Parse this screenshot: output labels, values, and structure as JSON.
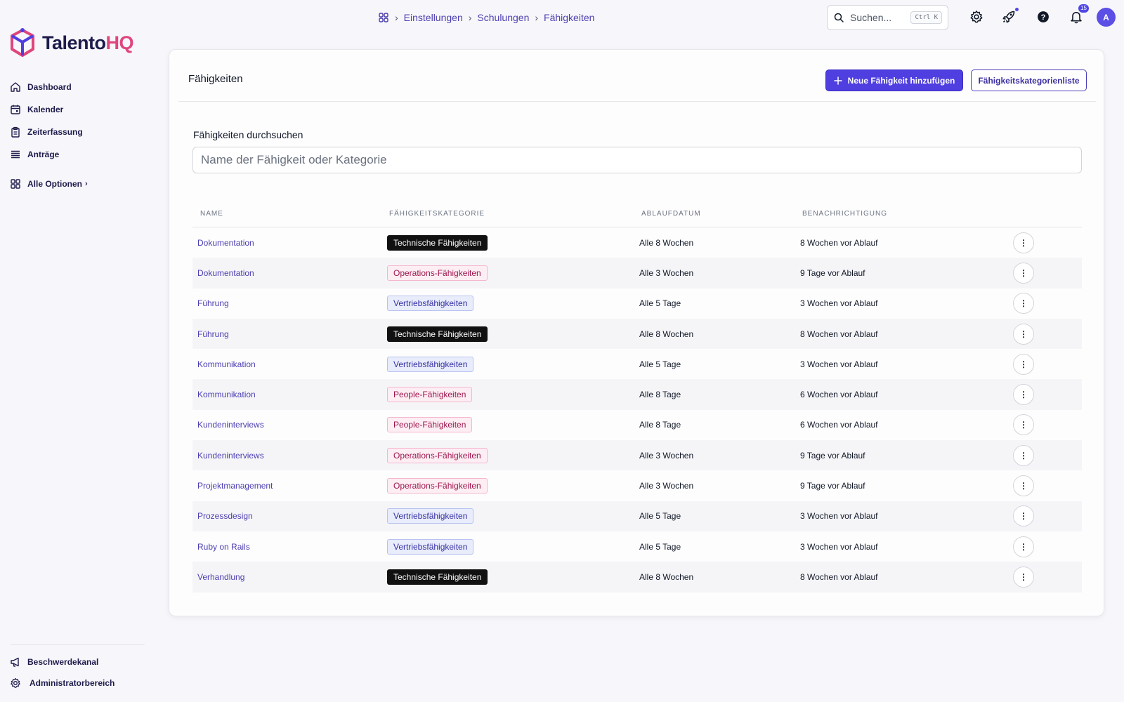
{
  "brand": {
    "name_main": "Talento",
    "name_accent": "HQ",
    "accent_color": "#e0457b",
    "primary_color": "#4f3ee0"
  },
  "sidebar": {
    "items": [
      {
        "label": "Dashboard",
        "icon": "home-icon"
      },
      {
        "label": "Kalender",
        "icon": "calendar-icon"
      },
      {
        "label": "Zeiterfassung",
        "icon": "clipboard-icon"
      },
      {
        "label": "Anträge",
        "icon": "list-icon"
      }
    ],
    "all_options": {
      "label": "Alle Optionen",
      "icon": "grid-icon"
    },
    "bottom": [
      {
        "label": "Beschwerdekanal",
        "icon": "megaphone-icon"
      },
      {
        "label": "Administratorbereich",
        "icon": "gear-icon"
      }
    ]
  },
  "breadcrumb": {
    "items": [
      "Einstellungen",
      "Schulungen",
      "Fähigkeiten"
    ]
  },
  "topbar": {
    "search_placeholder": "Suchen...",
    "search_shortcut": "Ctrl K",
    "notification_count": "15",
    "avatar_initial": "A"
  },
  "page": {
    "title": "Fähigkeiten",
    "add_button": "Neue Fähigkeit hinzufügen",
    "category_list_button": "Fähigkeitskategorienliste",
    "search_label": "Fähigkeiten durchsuchen",
    "search_placeholder": "Name der Fähigkeit oder Kategorie"
  },
  "table": {
    "headers": [
      "Name",
      "Fähigkeitskategorie",
      "Ablaufdatum",
      "Benachrichtigung"
    ],
    "rows": [
      {
        "name": "Dokumentation",
        "category": "Technische Fähigkeiten",
        "category_style": "dark",
        "expiry": "Alle 8 Wochen",
        "notification": "8 Wochen vor Ablauf"
      },
      {
        "name": "Dokumentation",
        "category": "Operations-Fähigkeiten",
        "category_style": "pink",
        "expiry": "Alle 3 Wochen",
        "notification": "9 Tage vor Ablauf"
      },
      {
        "name": "Führung",
        "category": "Vertriebsfähigkeiten",
        "category_style": "blue",
        "expiry": "Alle 5 Tage",
        "notification": "3 Wochen vor Ablauf"
      },
      {
        "name": "Führung",
        "category": "Technische Fähigkeiten",
        "category_style": "dark",
        "expiry": "Alle 8 Wochen",
        "notification": "8 Wochen vor Ablauf"
      },
      {
        "name": "Kommunikation",
        "category": "Vertriebsfähigkeiten",
        "category_style": "blue",
        "expiry": "Alle 5 Tage",
        "notification": "3 Wochen vor Ablauf"
      },
      {
        "name": "Kommunikation",
        "category": "People-Fähigkeiten",
        "category_style": "pink",
        "expiry": "Alle 8 Tage",
        "notification": "6 Wochen vor Ablauf"
      },
      {
        "name": "Kundeninterviews",
        "category": "People-Fähigkeiten",
        "category_style": "pink",
        "expiry": "Alle 8 Tage",
        "notification": "6 Wochen vor Ablauf"
      },
      {
        "name": "Kundeninterviews",
        "category": "Operations-Fähigkeiten",
        "category_style": "pink",
        "expiry": "Alle 3 Wochen",
        "notification": "9 Tage vor Ablauf"
      },
      {
        "name": "Projektmanagement",
        "category": "Operations-Fähigkeiten",
        "category_style": "pink",
        "expiry": "Alle 3 Wochen",
        "notification": "9 Tage vor Ablauf"
      },
      {
        "name": "Prozessdesign",
        "category": "Vertriebsfähigkeiten",
        "category_style": "blue",
        "expiry": "Alle 5 Tage",
        "notification": "3 Wochen vor Ablauf"
      },
      {
        "name": "Ruby on Rails",
        "category": "Vertriebsfähigkeiten",
        "category_style": "blue",
        "expiry": "Alle 5 Tage",
        "notification": "3 Wochen vor Ablauf"
      },
      {
        "name": "Verhandlung",
        "category": "Technische Fähigkeiten",
        "category_style": "dark",
        "expiry": "Alle 8 Wochen",
        "notification": "8 Wochen vor Ablauf"
      }
    ],
    "row_action_icon": "more-vertical-icon"
  }
}
